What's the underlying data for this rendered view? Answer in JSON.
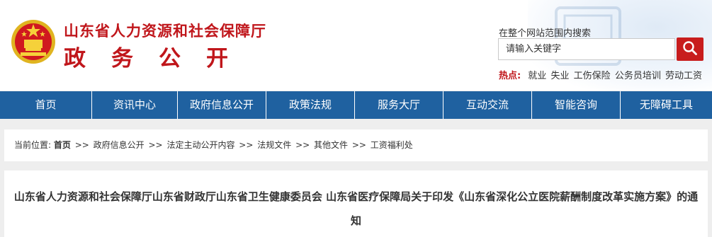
{
  "header": {
    "org_name": "山东省人力资源和社会保障厅",
    "sub_title": "政务公开",
    "search_hint": "在整个网站范围内搜索",
    "search_placeholder": "请输入关键字",
    "hot_label": "热点:",
    "hot_keywords": [
      "就业",
      "失业",
      "工伤保险",
      "公务员培训",
      "劳动工资"
    ]
  },
  "nav": {
    "items": [
      "首页",
      "资讯中心",
      "政府信息公开",
      "政策法规",
      "服务大厅",
      "互动交流",
      "智能咨询",
      "无障碍工具"
    ]
  },
  "breadcrumb": {
    "prefix": "当前位置:",
    "items": [
      "首页",
      "政府信息公开",
      "法定主动公开内容",
      "法规文件",
      "其他文件",
      "工资福利处"
    ],
    "separator": ">>"
  },
  "article": {
    "title": "山东省人力资源和社会保障厅山东省财政厅山东省卫生健康委员会 山东省医疗保障局关于印发《山东省深化公立医院薪酬制度改革实施方案》的通知"
  },
  "colors": {
    "brand_red": "#c0161b",
    "nav_blue": "#1f61a0",
    "search_button": "#c81d1d"
  },
  "icons": {
    "emblem": "national-emblem-icon",
    "search": "search-icon"
  }
}
